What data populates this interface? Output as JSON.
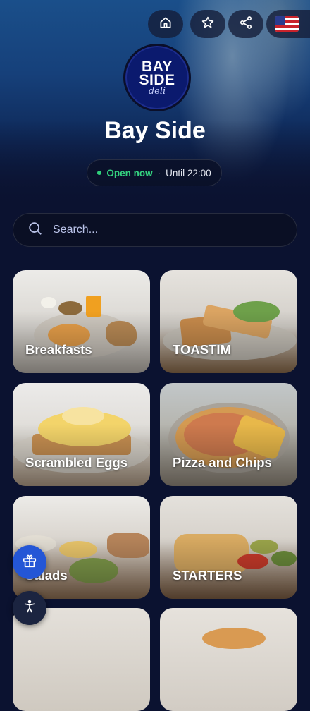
{
  "header": {
    "logo": {
      "line1": "BAY",
      "line2": "SIDE",
      "line3": "deli"
    },
    "store_name": "Bay Side",
    "status": {
      "open_label": "Open now",
      "separator": "·",
      "hours": "Until 22:00",
      "status_color": "#34d27f"
    },
    "actions": [
      {
        "icon": "home-icon"
      },
      {
        "icon": "star-icon"
      },
      {
        "icon": "share-icon"
      },
      {
        "icon": "us-flag-icon"
      }
    ]
  },
  "search": {
    "placeholder": "Search..."
  },
  "categories": [
    {
      "label": "Breakfasts"
    },
    {
      "label": "TOASTIM"
    },
    {
      "label": "Scrambled Eggs"
    },
    {
      "label": "Pizza and Chips"
    },
    {
      "label": "Salads"
    },
    {
      "label": "STARTERS"
    }
  ],
  "colors": {
    "background": "#0b1230",
    "accent": "#2456d6"
  },
  "floating": {
    "gift_icon": "gift-icon",
    "accessibility_icon": "accessibility-icon"
  }
}
